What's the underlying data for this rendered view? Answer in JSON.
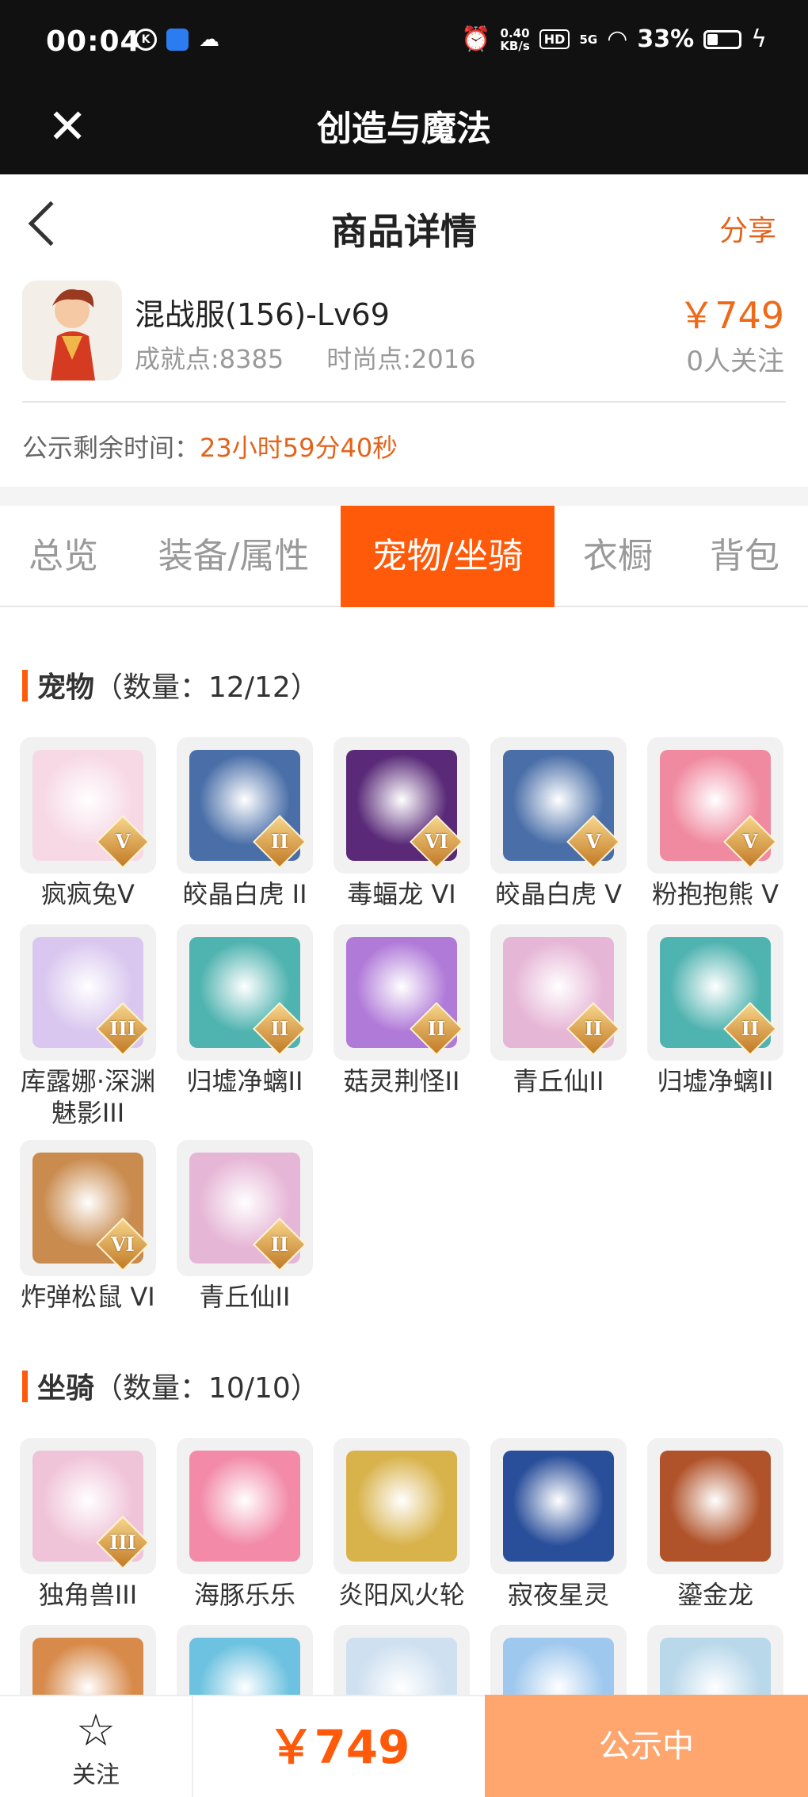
{
  "status_bar": {
    "time": "00:04",
    "net_speed_top": "0.40",
    "net_speed_bottom": "KB/s",
    "hd": "HD",
    "signal": "5G",
    "battery_pct": "33%"
  },
  "app_bar": {
    "title": "创造与魔法"
  },
  "header": {
    "title": "商品详情",
    "share": "分享"
  },
  "product": {
    "name": "混战服(156)-Lv69",
    "achievement": "成就点:8385",
    "fashion": "时尚点:2016",
    "price": "￥749",
    "followers": "0人关注",
    "countdown_label": "公示剩余时间：",
    "countdown_value": "23小时59分40秒"
  },
  "tabs": [
    "总览",
    "装备/属性",
    "宠物/坐骑",
    "衣橱",
    "背包"
  ],
  "active_tab": 2,
  "pets": {
    "title": "宠物",
    "count": "（数量：12/12）",
    "items": [
      {
        "name": "疯疯兔V",
        "badge": "V",
        "color": "#f7d9e6"
      },
      {
        "name": "皎晶白虎 II",
        "badge": "II",
        "color": "#4a6fa8"
      },
      {
        "name": "毒蝠龙 VI",
        "badge": "VI",
        "color": "#5a2a78"
      },
      {
        "name": "皎晶白虎 V",
        "badge": "V",
        "color": "#4a6fa8"
      },
      {
        "name": "粉抱抱熊 V",
        "badge": "V",
        "color": "#f08aa0"
      },
      {
        "name": "库露娜·深渊魅影III",
        "badge": "III",
        "color": "#d9c7ef"
      },
      {
        "name": "归墟净螭II",
        "badge": "II",
        "color": "#4fb3b0"
      },
      {
        "name": "菇灵荆怪II",
        "badge": "II",
        "color": "#b07ad8"
      },
      {
        "name": "青丘仙II",
        "badge": "II",
        "color": "#e6b6d6"
      },
      {
        "name": "归墟净螭II",
        "badge": "II",
        "color": "#4fb3b0"
      },
      {
        "name": "炸弹松鼠 VI",
        "badge": "VI",
        "color": "#c98b4e"
      },
      {
        "name": "青丘仙II",
        "badge": "II",
        "color": "#e6b6d6"
      }
    ]
  },
  "mounts": {
    "title": "坐骑",
    "count": "（数量：10/10）",
    "items": [
      {
        "name": "独角兽III",
        "badge": "III",
        "color": "#f0c4d8"
      },
      {
        "name": "海豚乐乐",
        "badge": "",
        "color": "#f28aa8"
      },
      {
        "name": "炎阳风火轮",
        "badge": "",
        "color": "#d8b24a"
      },
      {
        "name": "寂夜星灵",
        "badge": "",
        "color": "#2a4f9a"
      },
      {
        "name": "鎏金龙",
        "badge": "",
        "color": "#b0532a"
      },
      {
        "name": "",
        "badge": "",
        "color": "#d78a4a"
      },
      {
        "name": "",
        "badge": "",
        "color": "#6cc2e0"
      },
      {
        "name": "",
        "badge": "",
        "color": "#cfe0f0"
      },
      {
        "name": "",
        "badge": "",
        "color": "#9fc8ee"
      },
      {
        "name": "",
        "badge": "",
        "color": "#b9d8ea"
      }
    ]
  },
  "bottom_bar": {
    "follow_label": "关注",
    "price": "￥749",
    "status": "公示中"
  }
}
